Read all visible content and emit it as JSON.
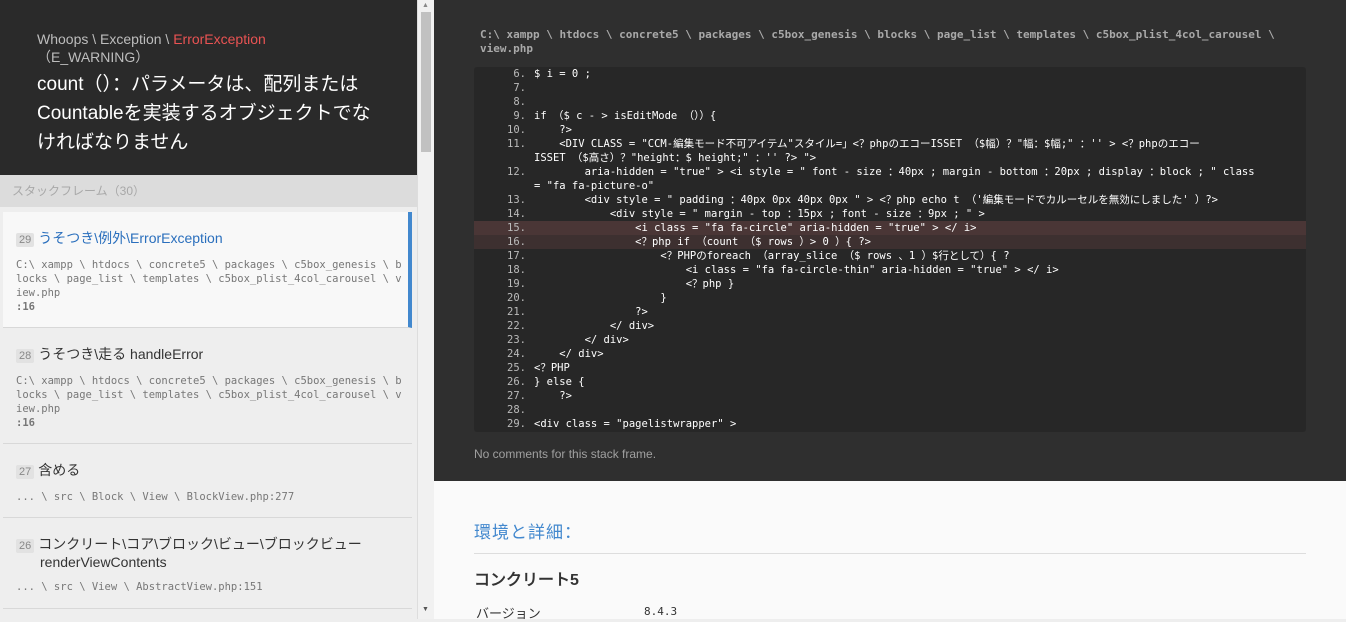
{
  "exception": {
    "class_prefix": "Whoops \\ Exception \\ ",
    "class_name": "ErrorException",
    "type": "（E_WARNING）",
    "message": "count（）：パラメータは、配列またはCountableを実装するオブジェクトでなければなりません"
  },
  "frames_header": "スタックフレーム（30）",
  "frames": [
    {
      "index": "29",
      "title": "うそつき\\例外\\ErrorException",
      "title2": "",
      "file": "C:\\ xampp \\ htdocs \\ concrete5 \\ packages \\ c5box_genesis \\ blocks \\ page_list \\ templates \\ c5box_plist_4col_carousel \\ view.php",
      "line": ":16"
    },
    {
      "index": "28",
      "title": "うそつき\\走る handleError",
      "title2": "",
      "file": "C:\\ xampp \\ htdocs \\ concrete5 \\ packages \\ c5box_genesis \\ blocks \\ page_list \\ templates \\ c5box_plist_4col_carousel \\ view.php",
      "line": ":16"
    },
    {
      "index": "27",
      "title": "含める",
      "title2": "",
      "file": "... \\ src \\ Block \\ View \\ BlockView.php:277",
      "line": ""
    },
    {
      "index": "26",
      "title": "コンクリート\\コア\\ブロック\\ビュー\\ブロックビュー",
      "title2": "renderViewContents",
      "file": "... \\ src \\ View \\ AbstractView.php:151",
      "line": ""
    }
  ],
  "code_file": "C:\\ xampp \\ htdocs \\ concrete5 \\ packages \\ c5box_genesis \\ blocks \\ page_list \\ templates \\ c5box_plist_4col_carousel \\ view.php",
  "code_lines": [
    {
      "n": "6.",
      "t": "$ i = 0 ;"
    },
    {
      "n": "7.",
      "t": ""
    },
    {
      "n": "8.",
      "t": ""
    },
    {
      "n": "9.",
      "t": "if （$ c - > isEditMode （））{"
    },
    {
      "n": "10.",
      "t": "    ?>"
    },
    {
      "n": "11.",
      "t": "    <DIV CLASS = \"CCM-編集モード不可アイテム\"スタイル=」<？phpのエコーISSET （$幅）？\"幅：$幅;\" ：'' > <？phpのエコー"
    },
    {
      "n": "",
      "t": "ISSET （$高さ）？\"height：$ height;\" ：'' ?> \">"
    },
    {
      "n": "12.",
      "t": "        aria-hidden = \"true\" > <i style = \" font - size ：40px ; margin - bottom ：20px ; display ：block ; \" class"
    },
    {
      "n": "",
      "t": "= \"fa fa-picture-o\""
    },
    {
      "n": "13.",
      "t": "        <div style = \" padding ：40px 0px 40px 0px \" > <？php echo t （'編集モードでカルーセルを無効にしました' ）?>"
    },
    {
      "n": "14.",
      "t": "            <div style = \" margin - top ：15px ; font - size ：9px ; \" >"
    },
    {
      "n": "15.",
      "t": "                <i class = \"fa fa-circle\" aria-hidden = \"true\" > </ i>"
    },
    {
      "n": "16.",
      "t": "                <？php if （count （$ rows ）> 0 ）{ ?>"
    },
    {
      "n": "17.",
      "t": "                    <？PHPのforeach （array_slice （$ rows 、1 ）$行として）{ ?"
    },
    {
      "n": "18.",
      "t": "                        <i class = \"fa fa-circle-thin\" aria-hidden = \"true\" > </ i>"
    },
    {
      "n": "19.",
      "t": "                        <？php }"
    },
    {
      "n": "20.",
      "t": "                    }"
    },
    {
      "n": "21.",
      "t": "                ?>"
    },
    {
      "n": "22.",
      "t": "            </ div>"
    },
    {
      "n": "23.",
      "t": "        </ div>"
    },
    {
      "n": "24.",
      "t": "    </ div>"
    },
    {
      "n": "25.",
      "t": "<？PHP"
    },
    {
      "n": "26.",
      "t": "} else {"
    },
    {
      "n": "27.",
      "t": "    ?>"
    },
    {
      "n": "28.",
      "t": ""
    },
    {
      "n": "29.",
      "t": "<div class = \"pagelistwrapper\" >"
    }
  ],
  "highlighted_line_indices": [
    11,
    12
  ],
  "frame_comment": "No comments for this stack frame.",
  "env": {
    "title": "環境と詳細：",
    "section": "コンクリート5",
    "version_label": "バージョン",
    "version_value": "8.4.3"
  },
  "colors": {
    "accent": "#4288ce",
    "error": "#e95353"
  }
}
